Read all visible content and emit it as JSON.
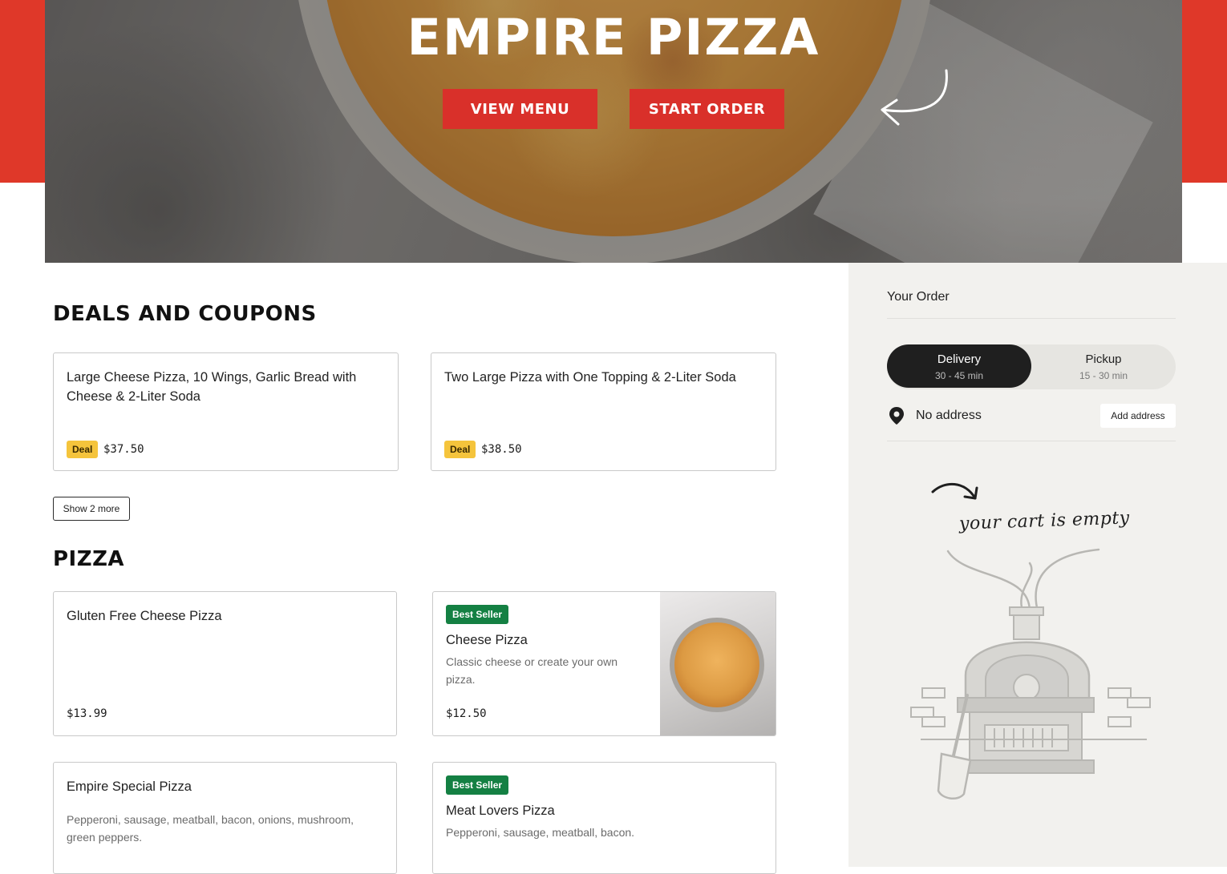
{
  "hero": {
    "title": "EMPIRE PIZZA",
    "view_menu_label": "VIEW MENU",
    "start_order_label": "START ORDER"
  },
  "deals": {
    "title": "DEALS AND COUPONS",
    "items": [
      {
        "title": "Large Cheese Pizza, 10 Wings, Garlic Bread with Cheese & 2-Liter Soda",
        "badge": "Deal",
        "price": "$37.50"
      },
      {
        "title": "Two Large Pizza with One Topping & 2-Liter Soda",
        "badge": "Deal",
        "price": "$38.50"
      }
    ],
    "show_more_label": "Show 2 more"
  },
  "pizza": {
    "title": "PIZZA",
    "items": [
      {
        "title": "Gluten Free Cheese Pizza",
        "price": "$13.99"
      },
      {
        "badge": "Best Seller",
        "title": "Cheese Pizza",
        "description": "Classic cheese or create your own pizza.",
        "price": "$12.50"
      },
      {
        "title": "Empire Special Pizza",
        "description": "Pepperoni, sausage, meatball, bacon, onions, mushroom, green peppers."
      },
      {
        "badge": "Best Seller",
        "title": "Meat Lovers Pizza",
        "description": "Pepperoni, sausage, meatball, bacon."
      }
    ]
  },
  "order": {
    "title": "Your Order",
    "delivery": {
      "label": "Delivery",
      "time": "30 - 45 min"
    },
    "pickup": {
      "label": "Pickup",
      "time": "15 - 30 min"
    },
    "address": "No address",
    "add_address_label": "Add address",
    "empty_cart_text": "your cart is empty"
  },
  "colors": {
    "brand_red": "#df3829",
    "deal_yellow": "#f5c43c",
    "best_seller_green": "#148043",
    "toggle_active": "#1f1f1f"
  },
  "icons": [
    "location-pin-icon",
    "curved-arrow-icon",
    "pizza-oven-illustration"
  ]
}
